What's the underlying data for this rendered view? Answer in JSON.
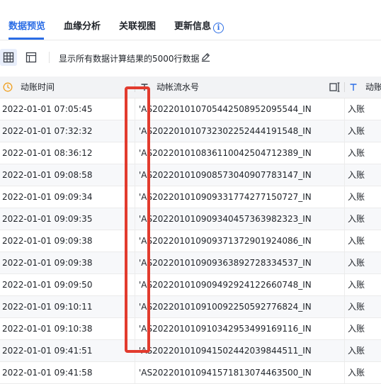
{
  "tabs": [
    {
      "label": "数据预览",
      "active": true
    },
    {
      "label": "血缘分析",
      "active": false
    },
    {
      "label": "关联视图",
      "active": false
    },
    {
      "label": "更新信息",
      "active": false
    }
  ],
  "toolbar": {
    "summary_text": "显示所有数据计算结果的5000行数据",
    "grid_view_icon": "grid-icon",
    "card_view_icon": "layout-icon",
    "edit_icon": "pencil-icon"
  },
  "table": {
    "columns": [
      {
        "label": "动账时间",
        "type_icon": "clock-icon"
      },
      {
        "label": "动帐流水号",
        "type_icon": "text-type-icon"
      },
      {
        "label": "动账",
        "type_icon": "text-type-icon"
      }
    ],
    "rows": [
      [
        "2022-01-01 07:05:45",
        "'AS20220101070544250895209554​4_IN",
        "入账"
      ],
      [
        "2022-01-01 07:32:32",
        "'AS20220101073230225244419154​8_IN",
        "入账"
      ],
      [
        "2022-01-01 08:36:12",
        "'AS20220101083611004250471238​9_IN",
        "入账"
      ],
      [
        "2022-01-01 09:08:58",
        "'AS20220101090857304090778314​7_IN",
        "入账"
      ],
      [
        "2022-01-01 09:09:34",
        "'AS20220101090933177427715072​7_IN",
        "入账"
      ],
      [
        "2022-01-01 09:09:35",
        "'AS20220101090934045736398232​3_IN",
        "入账"
      ],
      [
        "2022-01-01 09:09:38",
        "'AS20220101090937137290192408​6_IN",
        "入账"
      ],
      [
        "2022-01-01 09:09:38",
        "'AS20220101090936389272833453​7_IN",
        "入账"
      ],
      [
        "2022-01-01 09:09:50",
        "'AS20220101090949292412266074​8_IN",
        "入账"
      ],
      [
        "2022-01-01 09:10:11",
        "'AS20220101091009225059277682​4_IN",
        "入账"
      ],
      [
        "2022-01-01 09:10:38",
        "'AS20220101091034295349916911​6_IN",
        "入账"
      ],
      [
        "2022-01-01 09:41:51",
        "'AS20220101094150244203984451​1_IN",
        "入账"
      ],
      [
        "2022-01-01 09:41:58",
        "'AS20220101094157181307446350​0_IN",
        "入账"
      ]
    ]
  },
  "colors": {
    "accent": "#2b6de5",
    "highlight": "#e23b2e",
    "clock_icon": "#f0a020"
  }
}
